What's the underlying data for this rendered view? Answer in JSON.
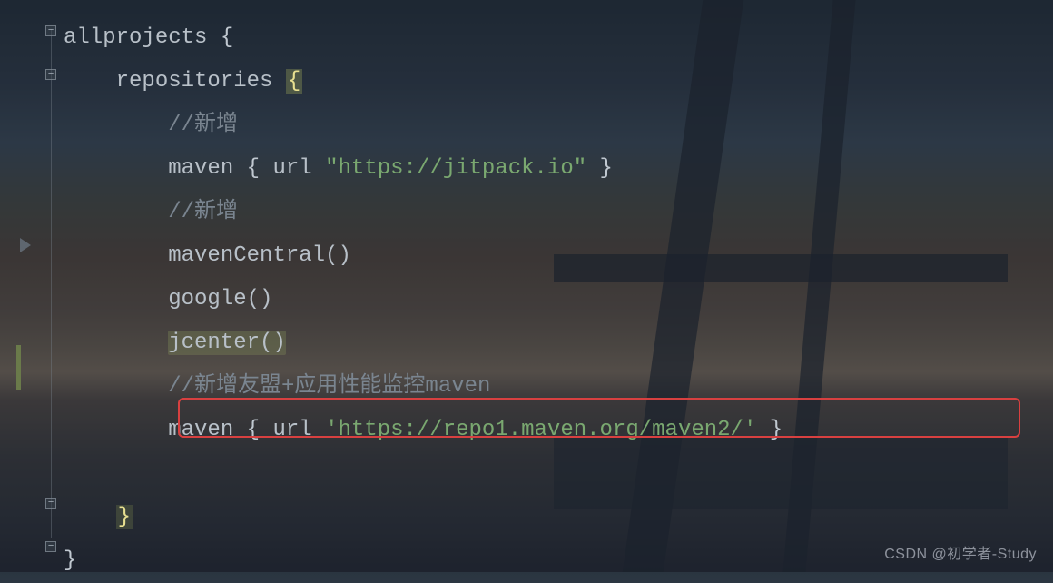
{
  "code": {
    "line1_kw": "allprojects",
    "line1_brace": " {",
    "line2_indent": "    ",
    "line2_kw": "repositories",
    "line2_space": " ",
    "line2_brace": "{",
    "line3": "        //新增",
    "line4_indent": "        ",
    "line4_maven": "maven",
    "line4_mid": " { ",
    "line4_url": "url",
    "line4_sp": " ",
    "line4_str": "\"https://jitpack.io\"",
    "line4_end": " }",
    "line5": "        //新增",
    "line6_indent": "        ",
    "line6_func": "mavenCentral()",
    "line7_indent": "        ",
    "line7_func": "google()",
    "line8_indent": "        ",
    "line8_func": "jcenter()",
    "line9": "        //新增友盟+应用性能监控maven",
    "line10_indent": "        ",
    "line10_maven": "maven",
    "line10_mid": " { ",
    "line10_url": "url",
    "line10_sp": " ",
    "line10_str": "'https://repo1.maven.org/maven2/'",
    "line10_end": " }",
    "line11": "",
    "line12_indent": "    ",
    "line12_brace": "}",
    "line13_brace": "}"
  },
  "watermark": "CSDN @初学者-Study"
}
